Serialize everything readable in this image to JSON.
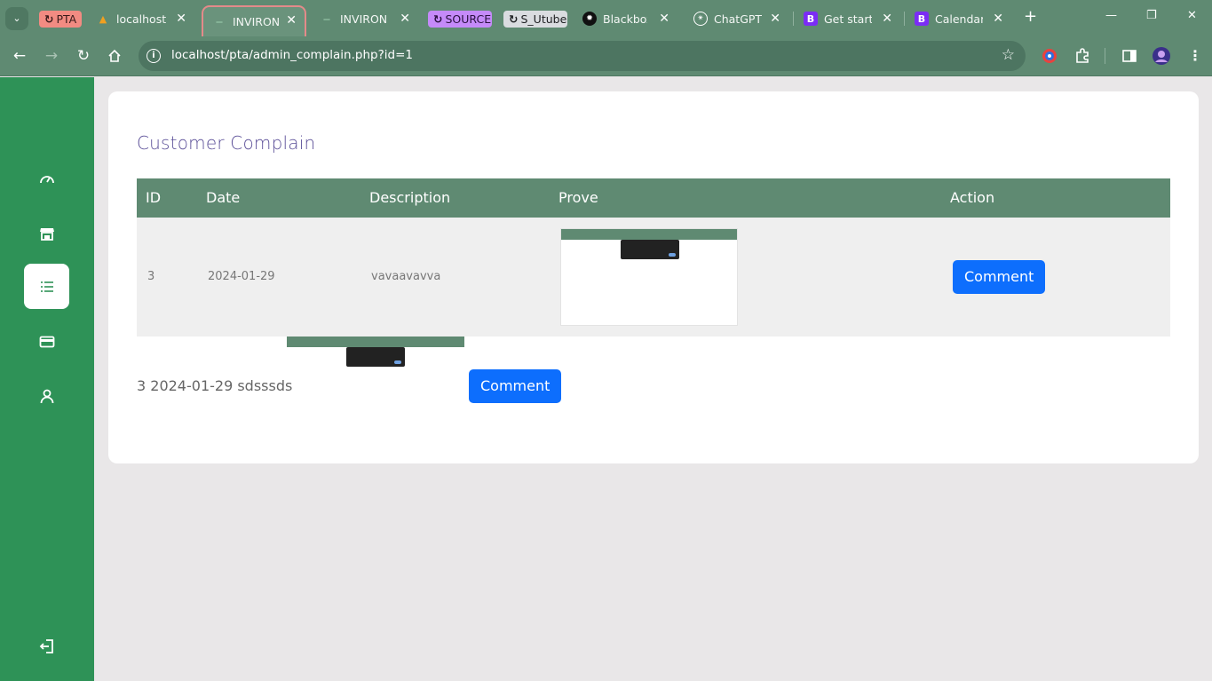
{
  "browser": {
    "tabs": [
      {
        "label": "PTA",
        "icon": "sync-icon",
        "style": "pill",
        "pill_color": "#f28b82"
      },
      {
        "label": "localhost /",
        "icon": "phpmyadmin-icon"
      },
      {
        "label": "INVIRON",
        "icon": "site-icon",
        "active": true
      },
      {
        "label": "INVIRON",
        "icon": "site-icon"
      },
      {
        "label": "SOURCE",
        "icon": "sync-icon",
        "style": "pill",
        "pill_color": "#c58af9"
      },
      {
        "label": "S_Utube",
        "icon": "sync-icon",
        "style": "pill",
        "pill_color": "#dadce0"
      },
      {
        "label": "Blackbox",
        "icon": "blackbox-icon"
      },
      {
        "label": "ChatGPT",
        "icon": "chatgpt-icon"
      },
      {
        "label": "Get starte",
        "icon": "bootstrap-icon"
      },
      {
        "label": "Calendar",
        "icon": "bootstrap-icon"
      }
    ],
    "url": "localhost/pta/admin_complain.php?id=1"
  },
  "sidebar": {
    "items": [
      {
        "name": "dashboard-icon"
      },
      {
        "name": "store-icon"
      },
      {
        "name": "list-icon",
        "active": true
      },
      {
        "name": "card-icon"
      },
      {
        "name": "user-icon"
      }
    ],
    "logout": "logout-icon"
  },
  "page": {
    "title": "Customer Complain",
    "table": {
      "headers": [
        "ID",
        "Date",
        "Description",
        "Prove",
        "Action"
      ],
      "rows": [
        {
          "id": "3",
          "date": "2024-01-29",
          "description": "vavaavavva",
          "action": "Comment"
        }
      ]
    },
    "row2": {
      "text": "3 2024-01-29 sdsssds",
      "action": "Comment"
    }
  },
  "colors": {
    "chrome": "#5f8a72",
    "sidebar": "#2e9257",
    "table_header": "#5f8a72",
    "button": "#0d6efd",
    "title": "#5b4f98"
  }
}
